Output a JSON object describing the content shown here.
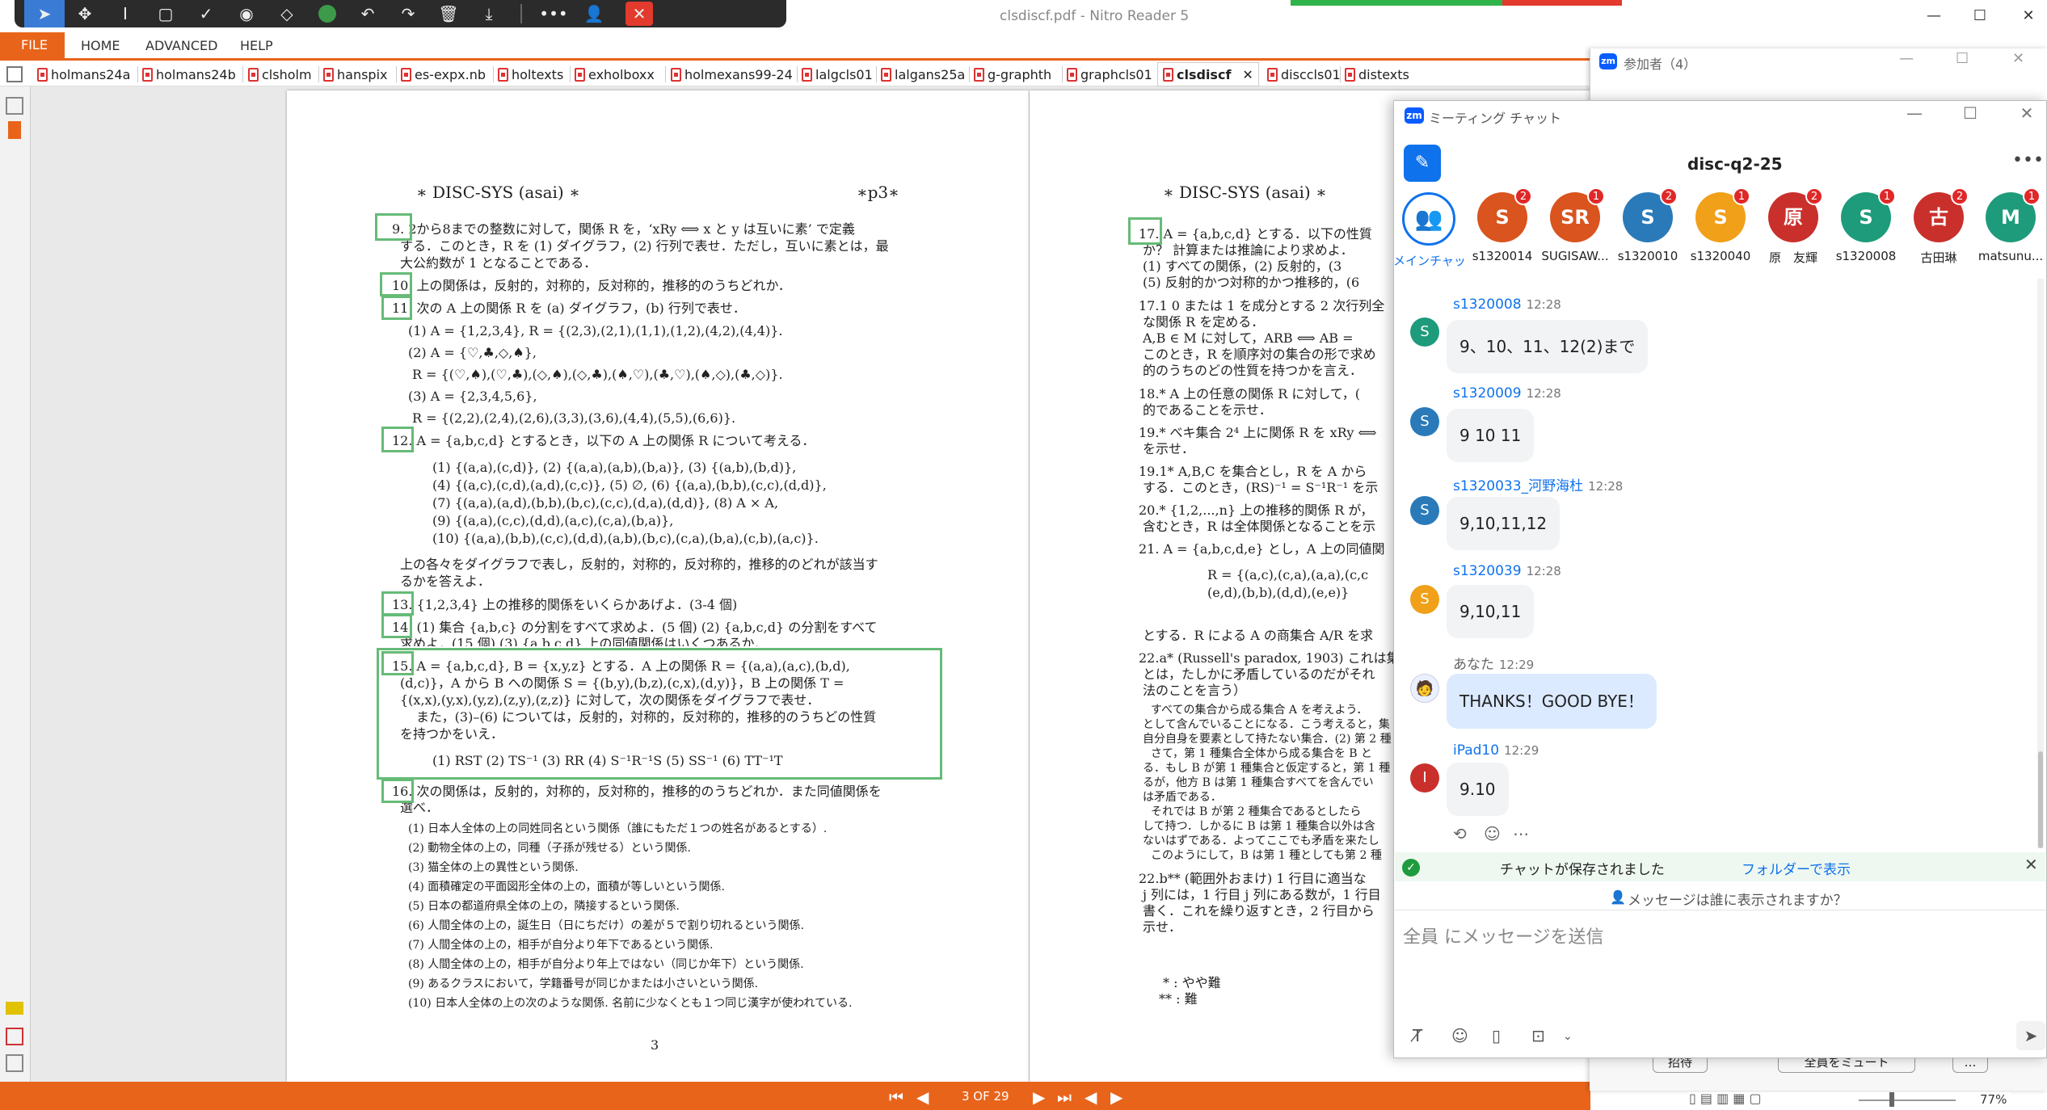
{
  "app": {
    "window_title": "clsdiscf.pdf - Nitro Reader 5",
    "menu_tabs": [
      "FILE",
      "HOME",
      "ADVANCED",
      "HELP"
    ],
    "toolbar_icons": [
      "select-arrow",
      "move",
      "text-cursor",
      "rectangle",
      "check",
      "stamp",
      "eraser",
      "color-dot",
      "undo",
      "redo",
      "trash",
      "download",
      "more",
      "user-add",
      "close"
    ]
  },
  "doc_tabs": [
    "holmans24a",
    "holmans24b",
    "clsholm",
    "hanspix",
    "es-expx.nb",
    "holtexts",
    "exholboxx",
    "holmexans99-24",
    "lalgcls01",
    "lalgans25a",
    "g-graphth",
    "graphcls01",
    "clsdiscf",
    "disccls01",
    "distexts"
  ],
  "active_tab": "clsdiscf",
  "page3": {
    "header_left": "∗ DISC-SYS (asai) ∗",
    "header_right": "∗p3∗",
    "lines": [
      "9. 2から8までの整数に対して，関係 R を，‘xRy ⟺ x と y は互いに素’ で定義",
      "する．このとき，R を (1) ダイグラフ，(2) 行列で表せ．ただし，互いに素とは，最",
      "大公約数が 1 となることである．",
      "10. 上の関係は，反射的，対称的，反対称的，推移的のうちどれか．",
      "11. 次の A 上の関係 R を (a) ダイグラフ，(b) 行列で表せ．",
      "(1) A = {1,2,3,4}, R = {(2,3),(2,1),(1,1),(1,2),(4,2),(4,4)}.",
      "(2) A = {♡,♣,◇,♠},",
      "R = {(♡,♠),(♡,♣),(◇,♠),(◇,♣),(♠,♡),(♣,♡),(♠,◇),(♣,◇)}.",
      "(3) A = {2,3,4,5,6},",
      "R = {(2,2),(2,4),(2,6),(3,3),(3,6),(4,4),(5,5),(6,6)}.",
      "12. A = {a,b,c,d} とするとき，以下の A 上の関係 R について考える．",
      "(1) {(a,a),(c,d)},    (2) {(a,a),(a,b),(b,a)},    (3) {(a,b),(b,d)},",
      "(4) {(a,c),(c,d),(a,d),(c,c)},    (5) ∅,    (6) {(a,a),(b,b),(c,c),(d,d)},",
      "(7) {(a,a),(a,d),(b,b),(b,c),(c,c),(d,a),(d,d)},    (8) A × A,",
      "(9) {(a,a),(c,c),(d,d),(a,c),(c,a),(b,a)},",
      "(10) {(a,a),(b,b),(c,c),(d,d),(a,b),(b,c),(c,a),(b,a),(c,b),(a,c)}.",
      "上の各々をダイグラフで表し，反射的，対称的，反対称的，推移的のどれが該当す",
      "るかを答えよ．",
      "13. {1,2,3,4} 上の推移的関係をいくらかあげよ．(3-4 個)",
      "14. (1) 集合 {a,b,c} の分割をすべて求めよ．(5 個) (2) {a,b,c,d} の分割をすべて",
      "求めよ．(15 個) (3) {a,b,c,d} 上の同値関係はいくつあるか．",
      "15. A = {a,b,c,d}, B = {x,y,z} とする．A 上の関係 R = {(a,a),(a,c),(b,d),",
      "(d,c)}，A から B への関係 S = {(b,y),(b,z),(c,x),(d,y)}，B 上の関係 T =",
      "{(x,x),(y,x),(y,z),(z,y),(z,z)} に対して，次の関係をダイグラフで表せ．",
      "また，(3)–(6) については，反射的，対称的，反対称的，推移的のうちどの性質",
      "を持つかをいえ．",
      "(1) RST   (2) TS⁻¹   (3) RR   (4) S⁻¹R⁻¹S   (5) SS⁻¹   (6) TT⁻¹T",
      "16. 次の関係は，反射的，対称的，反対称的，推移的のうちどれか．また同値関係を",
      "選べ．",
      "(1) 日本人全体の上の同姓同名という関係（誰にもただ１つの姓名があるとする）.",
      "(2) 動物全体の上の，同種（子孫が残せる）という関係.",
      "(3) 猫全体の上の異性という関係.",
      "(4) 面積確定の平面図形全体の上の，面積が等しいという関係.",
      "(5) 日本の都道府県全体の上の，隣接するという関係.",
      "(6) 人間全体の上の，誕生日（日にちだけ）の差が５で割り切れるという関係.",
      "(7) 人間全体の上の，相手が自分より年下であるという関係.",
      "(8) 人間全体の上の，相手が自分より年上ではない（同じか年下）という関係.",
      "(9) あるクラスにおいて，学籍番号が同じかまたは小さいという関係.",
      "(10) 日本人全体の上の次のような関係. 名前に少なくとも１つ同じ漢字が使われている.",
      "3"
    ]
  },
  "page4": {
    "header_left": "∗ DISC-SYS (asai) ∗",
    "lines": [
      "17. A = {a,b,c,d} とする．以下の性質",
      "か？ 計算または推論により求めよ．",
      "(1) すべての関係，(2) 反射的，(3",
      "(5) 反射的かつ対称的かつ推移的，(6",
      "17.1  0 または 1 を成分とする 2 次行列全",
      "な関係 R を定める．",
      "A,B ∈ M に対して，ARB ⟺ AB =",
      "このとき，R を順序対の集合の形で求め",
      "的のうちのどの性質を持つかを言え．",
      "18.* A 上の任意の関係 R に対して，(",
      "的であることを示せ．",
      "19.* べキ集合 2⁴ 上に関係 R を xRy ⟺",
      "を示せ．",
      "19.1* A,B,C を集合とし，R を A から",
      "する．このとき，(RS)⁻¹ = S⁻¹R⁻¹ を示",
      "20.* {1,2,...,n} 上の推移的関係 R が，",
      "含むとき，R は全体関係となることを示",
      "21. A = {a,b,c,d,e} とし，A 上の同値関",
      "R = {(a,c),(c,a),(a,a),(c,c",
      "(e,d),(b,b),(d,d),(e,e)}",
      "とする．R による A の商集合 A/R を求",
      "22.a* (Russell's paradox, 1903) これは集",
      "とは，たしかに矛盾しているのだがそれ",
      "法のことを言う）",
      "すべての集合から成る集合 A を考えよう．",
      "として含んでいることになる．こう考えると，集",
      "自分自身を要素として持たない集合．(2) 第 2 種",
      "さて，第 1 種集合全体から成る集合を B と",
      "る．もし B が第 1 種集合と仮定すると，第 1 種",
      "るが，他方 B は第 1 種集合すべてを含んでい",
      "は矛盾である．",
      "それでは B が第 2 種集合であるとしたら",
      "して持つ．しかるに B は第 1 種集合以外は含",
      "ないはずである．よってここでも矛盾を来たし",
      "このようにして，B は第 1 種としても第 2 種",
      "22.b** (範囲外おまけ) 1 行目に適当な",
      "j 列には，1 行目 j 列にある数が，1 行目",
      "書く．これを繰り返すとき，2 行目から",
      "示せ．",
      "* : やや難",
      "** : 難"
    ]
  },
  "statusbar": {
    "page_count": "3 OF 29",
    "zoom": "77%"
  },
  "participants": {
    "title": "参加者（4）",
    "btn_invite": "招待",
    "btn_mute": "全員をミュート"
  },
  "chat": {
    "title": "ミーティング チャット",
    "channel": "disc-q2-25",
    "avatars": [
      {
        "initials": "",
        "name": "メインチャット",
        "color": "#ffffff",
        "badge": ""
      },
      {
        "initials": "S",
        "name": "s1320014",
        "color": "#d9541e",
        "badge": "2"
      },
      {
        "initials": "SR",
        "name": "SUGISAW...",
        "color": "#d9541e",
        "badge": "1"
      },
      {
        "initials": "S",
        "name": "s1320010",
        "color": "#2a7ab9",
        "badge": "2"
      },
      {
        "initials": "S",
        "name": "s1320040",
        "color": "#f0a019",
        "badge": "1"
      },
      {
        "initials": "原",
        "name": "原　友輝",
        "color": "#c9302c",
        "badge": "2"
      },
      {
        "initials": "S",
        "name": "s1320008",
        "color": "#1e9b7b",
        "badge": "1"
      },
      {
        "initials": "古",
        "name": "古田琳",
        "color": "#c9302c",
        "badge": "2"
      },
      {
        "initials": "M",
        "name": "matsunu...",
        "color": "#1e9b7b",
        "badge": "1"
      }
    ],
    "messages": [
      {
        "sender": "s1320008",
        "time": "12:28",
        "text": "9、10、11、12(2)まで",
        "initial": "S",
        "color": "#1e9b7b"
      },
      {
        "sender": "s1320009",
        "time": "12:28",
        "text": "9 10 11",
        "initial": "S",
        "color": "#2a7ab9"
      },
      {
        "sender": "s1320033_河野海杜",
        "time": "12:28",
        "text": "9,10,11,12",
        "initial": "S",
        "color": "#2a7ab9"
      },
      {
        "sender": "s1320039",
        "time": "12:28",
        "text": "9,10,11",
        "initial": "S",
        "color": "#f0a019"
      },
      {
        "sender": "あなた",
        "time": "12:29",
        "text": "THANKS！GOOD BYE！",
        "initial": "",
        "color": "#ffffff"
      },
      {
        "sender": "iPad10",
        "time": "12:29",
        "text": "9.10",
        "initial": "I",
        "color": "#c9302c"
      }
    ],
    "saved_text": "チャットが保存されました",
    "saved_link": "フォルダーで表示",
    "visibility": "メッセージは誰に表示されますか？",
    "input_placeholder": "全員 にメッセージを送信"
  }
}
